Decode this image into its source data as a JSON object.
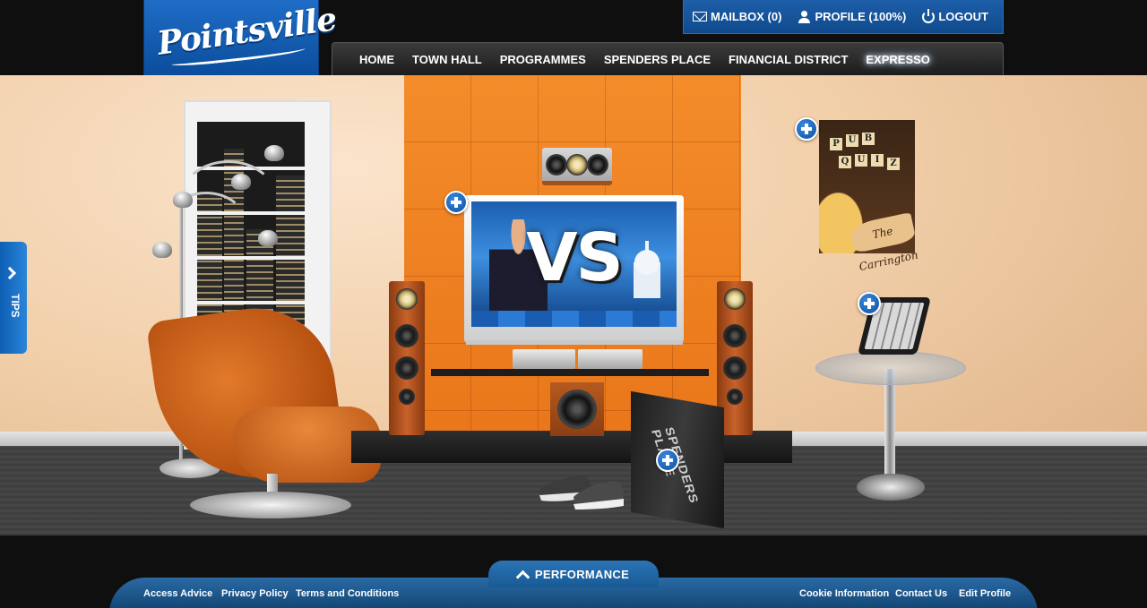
{
  "brand": {
    "logo_text": "Pointsville"
  },
  "user_menu": {
    "mailbox": "MAILBOX (0)",
    "profile": "PROFILE (100%)",
    "logout": "LOGOUT"
  },
  "nav": {
    "items": [
      "HOME",
      "TOWN HALL",
      "PROGRAMMES",
      "SPENDERS PLACE",
      "FINANCIAL DISTRICT",
      "EXPRESSO"
    ]
  },
  "scene": {
    "tv_text": "VS",
    "bag_text": "SPENDERS PLACE",
    "poster_title": [
      "P",
      "U",
      "B",
      "Q",
      "U",
      "I",
      "Z"
    ],
    "poster_brand": "The Carrington"
  },
  "tips": {
    "label": "TIPS"
  },
  "footer": {
    "performance": "PERFORMANCE",
    "left_links": [
      "Access Advice",
      "Privacy Policy",
      "Terms and Conditions"
    ],
    "right_links": [
      "Cookie Information",
      "Contact Us",
      "Edit Profile"
    ]
  },
  "colors": {
    "brand_blue": "#0e5bb0",
    "orange_wall": "#f07f22",
    "header_bg": "#0f0f0f"
  }
}
